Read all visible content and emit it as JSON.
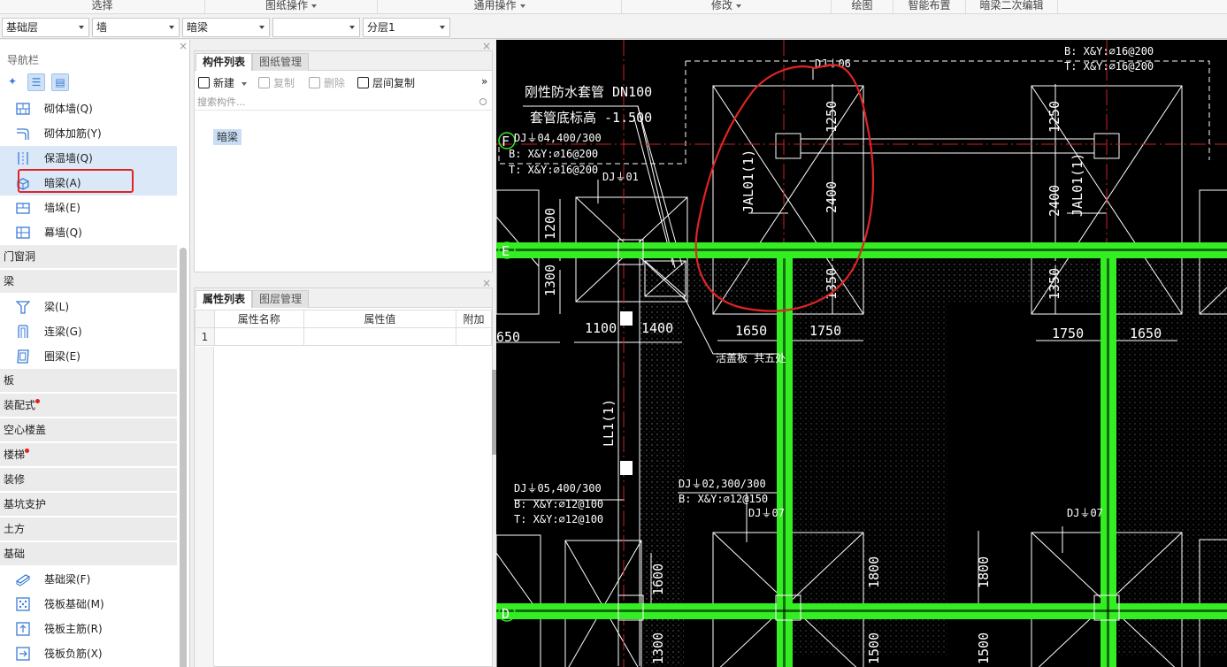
{
  "ribbon": {
    "groups": [
      {
        "label": "选择",
        "has_menu": false
      },
      {
        "label": "图纸操作",
        "has_menu": true
      },
      {
        "label": "通用操作",
        "has_menu": true
      },
      {
        "label": "修改",
        "has_menu": true
      },
      {
        "label": "绘图",
        "has_menu": false
      },
      {
        "label": "智能布置",
        "has_menu": false
      },
      {
        "label": "暗梁二次编辑",
        "has_menu": false
      }
    ]
  },
  "selectors": {
    "floor": "基础层",
    "category": "墙",
    "type": "暗梁",
    "component": "",
    "layer": "分层1"
  },
  "nav": {
    "title": "导航栏",
    "close": "×",
    "items": {
      "masonry_wall": "砌体墙(Q)",
      "masonry_rebar": "砌体加筋(Y)",
      "insulation_wall": "保温墙(Q)",
      "hidden_beam": "暗梁(A)",
      "wall_pier": "墙垛(E)",
      "curtain_wall": "幕墙(Q)",
      "beam": "梁(L)",
      "coupling_beam": "连梁(G)",
      "ring_beam": "圈梁(E)",
      "foundation_beam": "基础梁(F)",
      "raft_foundation": "筏板基础(M)",
      "raft_main_rebar": "筏板主筋(R)",
      "raft_neg_rebar": "筏板负筋(X)"
    },
    "categories": {
      "door_window": "门窗洞",
      "beam": "梁",
      "slab": "板",
      "prefab": "装配式",
      "hollow_floor": "空心楼盖",
      "stairs": "楼梯",
      "decoration": "装修",
      "pit_support": "基坑支护",
      "earthwork": "土方",
      "foundation": "基础"
    }
  },
  "component_panel": {
    "tabs": [
      "构件列表",
      "图纸管理"
    ],
    "close": "×",
    "toolbar": {
      "new": "新建",
      "copy": "复制",
      "delete": "删除",
      "floor_copy": "层间复制",
      "more": "»"
    },
    "search_placeholder": "搜索构件...",
    "items": [
      "暗梁"
    ]
  },
  "property_panel": {
    "tabs": [
      "属性列表",
      "图层管理"
    ],
    "close": "×",
    "columns": [
      "属性名称",
      "属性值",
      "附加"
    ],
    "rows": [
      {
        "index": "1",
        "name": "",
        "value": "",
        "extra": ""
      }
    ]
  },
  "cad": {
    "labels": {
      "pipe_title": "刚性防水套管 DN100",
      "pipe_elev": "套管底标高 -1.500",
      "cover_note": "活盖板  共五处",
      "dj06": "DJ⏚06",
      "dj01": "DJ⏚01",
      "dj04": "DJ⏚04,400/300",
      "dj04_b": "B: X&Y:⌀16@200",
      "dj04_t": "T: X&Y:⌀16@200",
      "tr_b": "B: X&Y:⌀16@200",
      "tr_t": "T: X&Y:⌀16@200",
      "dj05": "DJ⏚05,400/300",
      "dj05_b": "B: X&Y:⌀12@100",
      "dj05_t": "T: X&Y:⌀12@100",
      "dj02": "DJ⏚02,300/300",
      "dj02_b": "B: X&Y:⌀12@150",
      "dj07a": "DJ⏚07",
      "dj07b": "DJ⏚07",
      "jal_left": "JAL01(1)",
      "jal_right": "JAL01(1)",
      "ll": "LL1(1)",
      "axis_f": "F",
      "axis_e": "E",
      "axis_d": "D"
    },
    "dims": {
      "d1250a": "1250",
      "d1250b": "1250",
      "d2400a": "2400",
      "d2400b": "2400",
      "d1200": "1200",
      "d1300a": "1300",
      "d1350a": "1350",
      "d1350b": "1350",
      "d650": "650",
      "d1100": "1100",
      "d1400": "1400",
      "d1650a": "1650",
      "d1750a": "1750",
      "d1750b": "1750",
      "d1650b": "1650",
      "d1600": "1600",
      "d1800a": "1800",
      "d1800b": "1800",
      "d1300b": "1300",
      "d1500a": "1500",
      "d1500b": "1500"
    },
    "colors": {
      "background": "#000000",
      "beam": "#33ee22",
      "line": "#ffffff",
      "axis": "#cc2222",
      "markup": "#e02424"
    }
  }
}
